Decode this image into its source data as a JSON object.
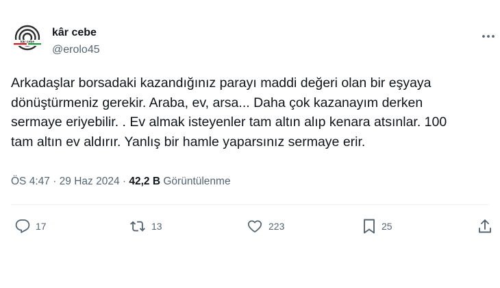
{
  "author": {
    "name": "kâr cebe",
    "handle": "@erolo45",
    "avatar_icon": "target-logo-icon",
    "avatar_logo_text": "kâr cebe"
  },
  "tweet": {
    "text_lines": [
      "Arkadaşlar borsadaki kazandığınız parayı maddi değeri olan bir eşyaya",
      "dönüştürmeniz gerekir. Araba, ev, arsa... Daha çok kazanayım derken",
      "sermaye eriyebilir. . Ev almak isteyenler tam altın alıp kenara atsınlar. 100",
      "tam altın ev aldırır. Yanlış bir hamle yaparsınız sermaye erir."
    ],
    "time": "ÖS 4:47",
    "separator": "·",
    "date": "29 Haz 2024",
    "views_count": "42,2 B",
    "views_label": "Görüntülenme"
  },
  "actions": {
    "replies": "17",
    "retweets": "13",
    "likes": "223",
    "bookmarks": "25"
  },
  "colors": {
    "text": "#0f1419",
    "secondary": "#536471",
    "divider": "#eff3f4"
  }
}
